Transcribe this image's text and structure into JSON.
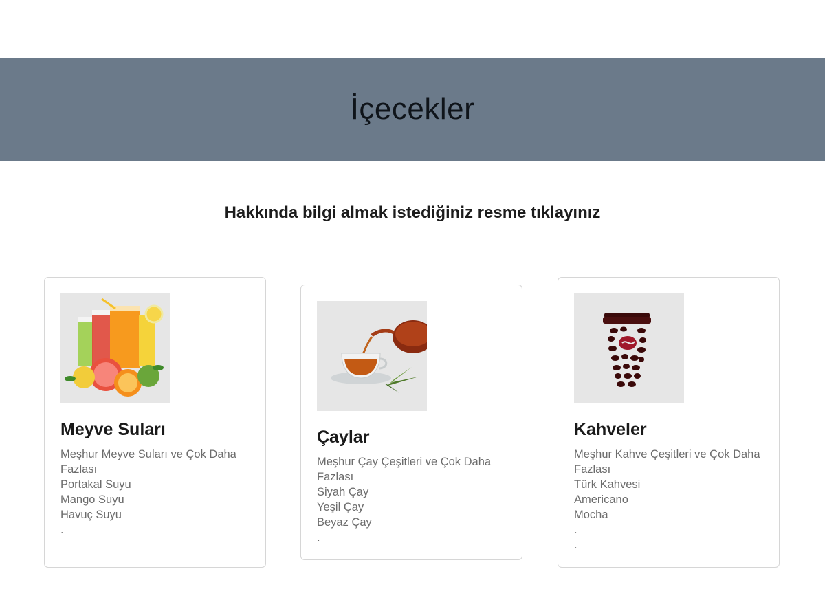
{
  "header": {
    "title": "İçecekler"
  },
  "intro": {
    "text": "Hakkında bilgi almak istediğiniz resme tıklayınız"
  },
  "cards": [
    {
      "title": "Meyve Suları",
      "image": "fruit-juice-glasses-image",
      "lines": [
        "Meşhur Meyve Suları ve Çok Daha",
        "Fazlası",
        "Portakal Suyu",
        "Mango Suyu",
        "Havuç Suyu",
        "."
      ]
    },
    {
      "title": "Çaylar",
      "image": "tea-pouring-image",
      "lines": [
        "Meşhur Çay Çeşitleri ve Çok Daha",
        "Fazlası",
        "Siyah Çay",
        "Yeşil Çay",
        "Beyaz Çay",
        "."
      ]
    },
    {
      "title": "Kahveler",
      "image": "coffee-cup-image",
      "lines": [
        "Meşhur Kahve Çeşitleri ve Çok Daha",
        "Fazlası",
        "Türk Kahvesi",
        "Americano",
        "Mocha",
        ".",
        "."
      ]
    }
  ],
  "colors": {
    "banner": "#6b7a8a",
    "card_border": "#d6d6d6",
    "image_bg": "#e6e6e6",
    "muted_text": "#6c6c6c"
  }
}
